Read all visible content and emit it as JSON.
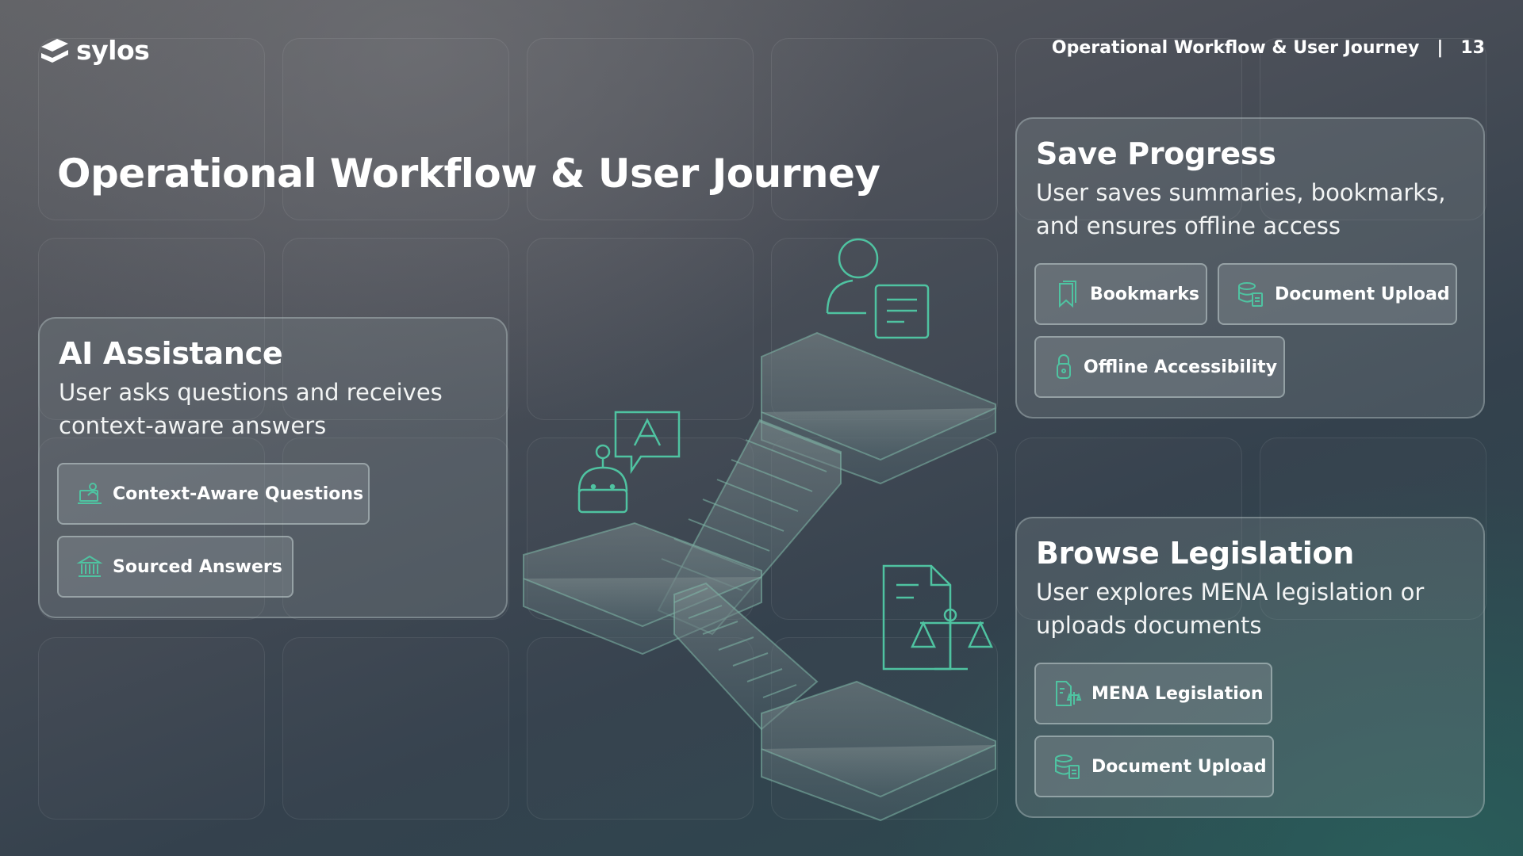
{
  "brand": {
    "name": "sylos"
  },
  "header": {
    "section_title": "Operational Workflow & User Journey",
    "separator": "|",
    "page_number": "13"
  },
  "page_title": "Operational Workflow & User Journey",
  "cards": {
    "ai_assistance": {
      "title": "AI Assistance",
      "description": "User asks questions and receives context-aware answers",
      "chips": [
        {
          "label": "Context-Aware Questions",
          "icon": "laptop-person-icon"
        },
        {
          "label": "Sourced Answers",
          "icon": "institution-icon"
        }
      ]
    },
    "save_progress": {
      "title": "Save Progress",
      "description": "User saves summaries, bookmarks, and ensures offline access",
      "chips": [
        {
          "label": "Bookmarks",
          "icon": "bookmark-icon"
        },
        {
          "label": "Document Upload",
          "icon": "database-document-icon"
        },
        {
          "label": "Offline Accessibility",
          "icon": "lock-icon"
        }
      ]
    },
    "browse_legislation": {
      "title": "Browse Legislation",
      "description": "User explores MENA legislation or uploads documents",
      "chips": [
        {
          "label": "MENA Legislation",
          "icon": "document-scale-icon"
        },
        {
          "label": "Document Upload",
          "icon": "database-document-icon"
        }
      ]
    }
  },
  "colors": {
    "accent": "#4fc3a1",
    "background_dark": "#2a4a4f",
    "background_light": "#616266"
  }
}
